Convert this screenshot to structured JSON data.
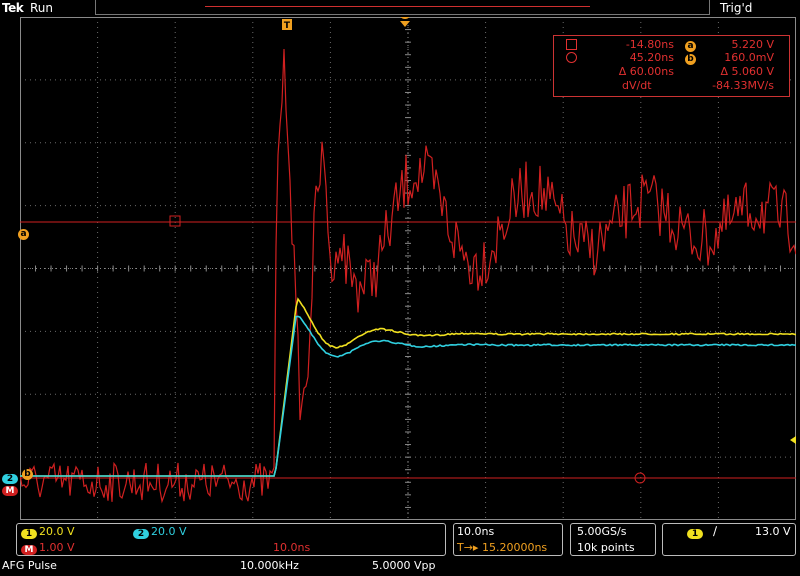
{
  "header": {
    "logo": "Tek",
    "run_state": "Run",
    "trigger_state": "Trig'd",
    "trigger_marker": "T"
  },
  "colors": {
    "ch1": "#f0e020",
    "ch2": "#30d0e0",
    "math": "#d02020",
    "cursor": "#f0a020",
    "grid": "#7a7a7a"
  },
  "markers": {
    "cursor_a": "a",
    "cursor_b": "b",
    "ch2_ground": "2",
    "math_ground": "M"
  },
  "cursor_readout": {
    "t1_value": "-14.80ns",
    "t2_value": "45.20ns",
    "dt_value": "Δ 60.00ns",
    "a_label": "a",
    "b_label": "b",
    "a_value": "5.220 V",
    "b_value": "160.0mV",
    "dv_value": "Δ 5.060 V",
    "dvdt_label": "dV/dt",
    "dvdt_value": "-84.33MV/s"
  },
  "status": {
    "ch1_tag": "1",
    "ch1_scale": "20.0 V",
    "ch2_tag": "2",
    "ch2_scale": "20.0 V",
    "math_tag": "M",
    "math_scale": "1.00 V",
    "math_time": "10.0ns",
    "afg_label": "AFG Pulse",
    "afg_freq": "10.000kHz",
    "afg_amp": "5.0000 Vpp",
    "timebase": "10.0ns",
    "trig_pos": "T→▸ 15.20000ns",
    "sample_rate": "5.00GS/s",
    "record_len": "10k points",
    "trig_src_tag": "1",
    "trig_slope": "∕",
    "trig_level": "13.0 V"
  }
}
